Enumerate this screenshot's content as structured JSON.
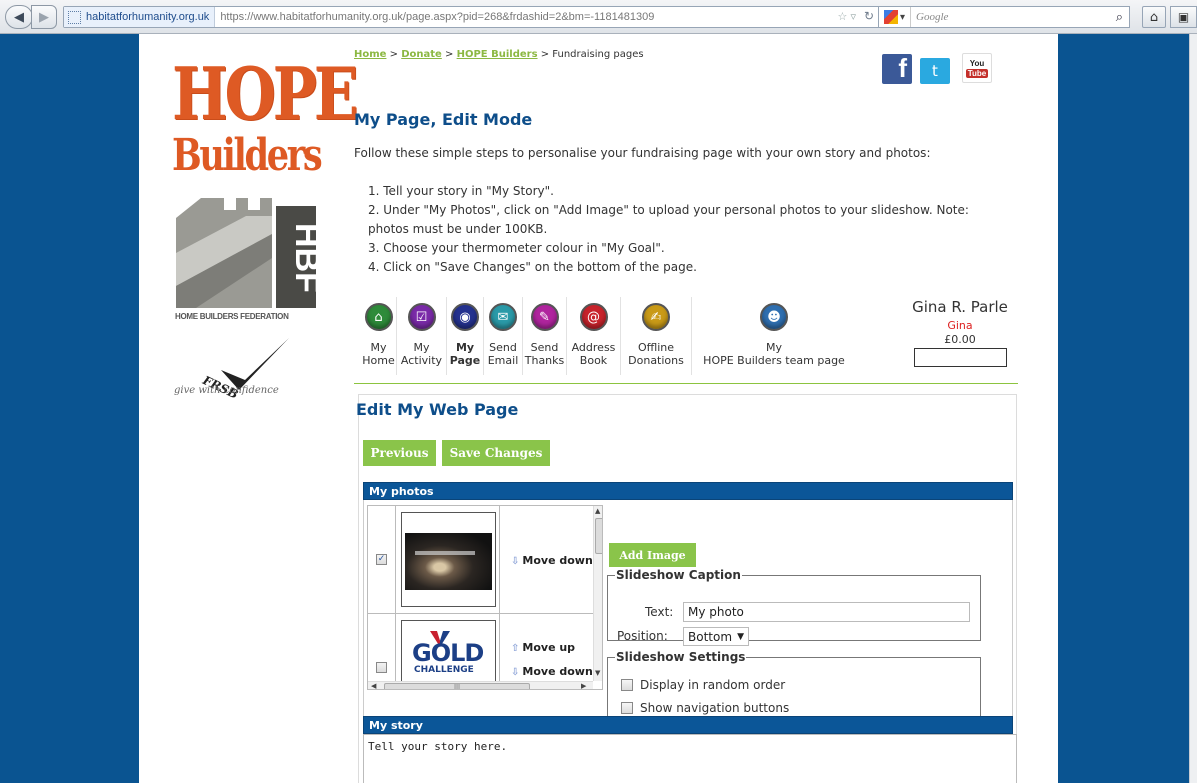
{
  "browser": {
    "site_identity": "habitatforhumanity.org.uk",
    "url": "https://www.habitatforhumanity.org.uk/page.aspx?pid=268&frdashid=2&bm=-1181481309",
    "search_engine": "Google",
    "search_placeholder": "Google"
  },
  "sidebar": {
    "logo_line1": "HOPE",
    "logo_line2": "Builders",
    "hbf_caption": "HOME BUILDERS FEDERATION",
    "frsb_mark": "FRSB",
    "frsb_tagline": "give with confidence"
  },
  "breadcrumb": {
    "items": [
      "Home",
      "Donate",
      "HOPE Builders"
    ],
    "separator": ">",
    "current": "Fundraising pages"
  },
  "social": {
    "facebook": "f",
    "twitter": "t",
    "youtube_top": "You",
    "youtube_bottom": "Tube"
  },
  "main": {
    "title": "My Page, Edit Mode",
    "intro": "Follow these simple steps to personalise your fundraising page with your own story and photos:",
    "steps": [
      "1. Tell your story in \"My Story\".",
      "2. Under \"My Photos\", click on \"Add Image\" to upload your personal photos to your slideshow. Note: photos must be under 100KB.",
      "3. Choose your thermometer colour in \"My Goal\".",
      "4. Click on \"Save Changes\" on the bottom of the page."
    ]
  },
  "nav": {
    "items": [
      {
        "line1": "My",
        "line2": "Home",
        "icon": "house-icon",
        "color": "#2e8b3a"
      },
      {
        "line1": "My",
        "line2": "Activity",
        "icon": "checklist-icon",
        "color": "#7a2aa8"
      },
      {
        "line1": "My",
        "line2": "Page",
        "icon": "page-icon",
        "color": "#24328f"
      },
      {
        "line1": "Send",
        "line2": "Email",
        "icon": "envelope-icon",
        "color": "#2a9aa8"
      },
      {
        "line1": "Send",
        "line2": "Thanks",
        "icon": "thanks-icon",
        "color": "#b0249e"
      },
      {
        "line1": "Address",
        "line2": "Book",
        "icon": "address-book-icon",
        "color": "#c8232b"
      },
      {
        "line1": "Offline",
        "line2": "Donations",
        "icon": "donations-icon",
        "color": "#c99a17"
      },
      {
        "line1": "My",
        "line2": "HOPE Builders team page",
        "icon": "team-icon",
        "color": "#2f6fb0"
      }
    ],
    "active_index": 2
  },
  "user": {
    "name": "Gina R. Parle",
    "nickname": "Gina",
    "amount": "£0.00"
  },
  "edit": {
    "title": "Edit My Web Page",
    "previous_label": "Previous",
    "save_label": "Save Changes"
  },
  "photos": {
    "section_title": "My photos",
    "rows": [
      {
        "checked": true,
        "image": "dark workshop photo",
        "actions": [
          "Move down"
        ]
      },
      {
        "checked": false,
        "image": "Gold Challenge logo",
        "actions": [
          "Move up",
          "Move down"
        ]
      }
    ],
    "row1_check": "✓",
    "gold_text": "GOLD",
    "gold_sub": "CHALLENGE",
    "add_image_label": "Add Image",
    "caption_legend": "Slideshow Caption",
    "text_label": "Text:",
    "text_value": "My photo",
    "position_label": "Position:",
    "position_value": "Bottom",
    "settings_legend": "Slideshow Settings",
    "random_label": "Display in random order",
    "nav_buttons_label": "Show navigation buttons"
  },
  "story": {
    "section_title": "My story",
    "placeholder": "Tell your story here."
  },
  "colors": {
    "page_bg": "#0a5491",
    "accent_green": "#8ac44a",
    "heading_blue": "#0e4e8a",
    "logo_orange": "#de5a24"
  }
}
